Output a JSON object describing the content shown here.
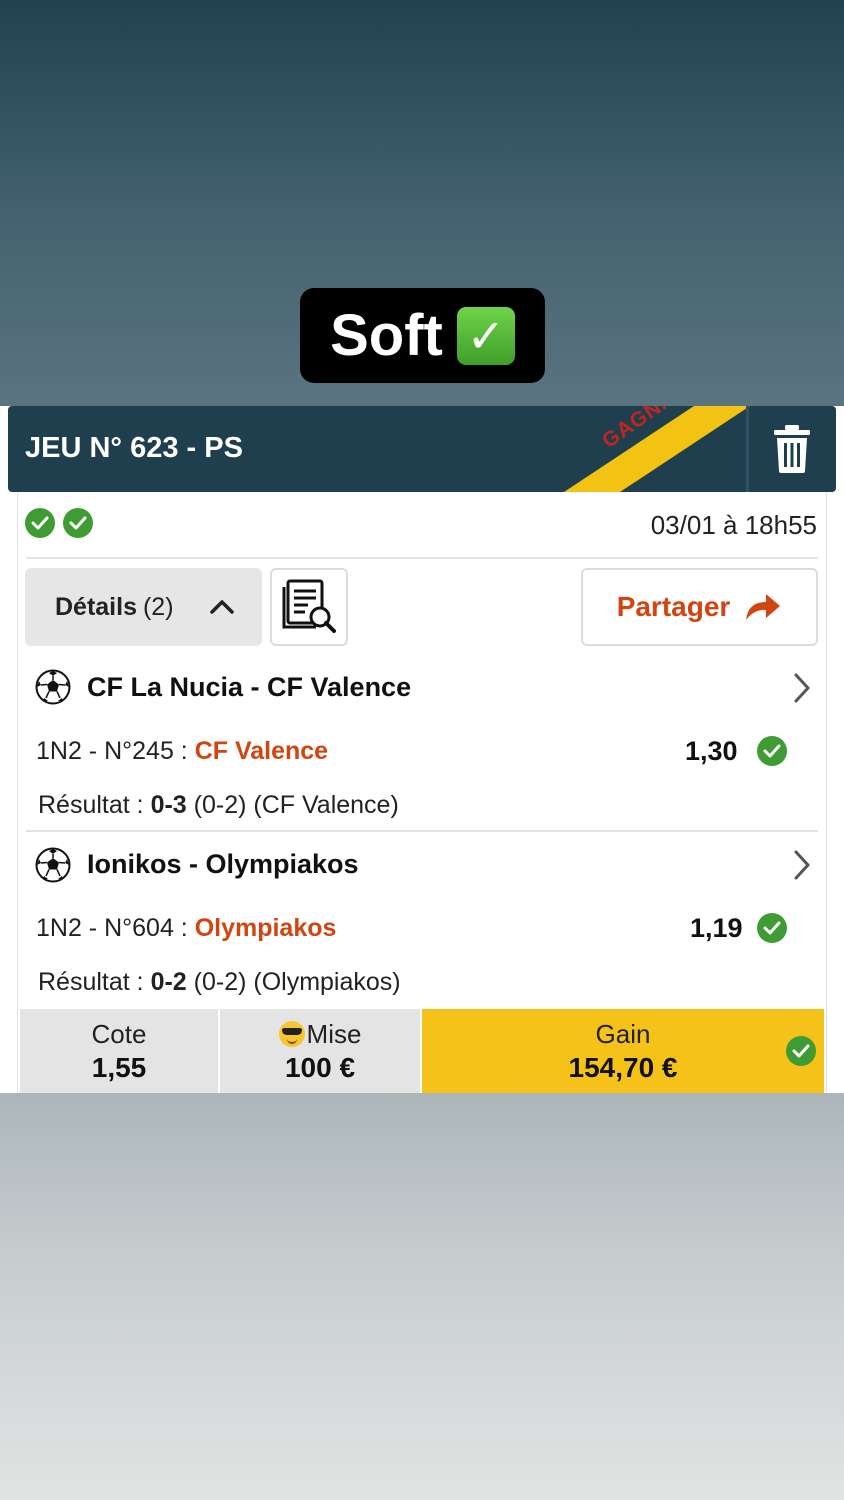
{
  "sticker": {
    "text": "Soft",
    "emoji": "check-mark-button"
  },
  "ticket": {
    "title": "JEU N° 623 - PS",
    "ribbon": "GAGNANT",
    "date": "03/01 à 18h55",
    "details_label": "Détails",
    "details_count": "(2)",
    "share_label": "Partager",
    "colors": {
      "header": "#1f3f4e",
      "ribbon": "#f3c313",
      "accent": "#d24410",
      "success": "#3f9c35",
      "gain_bg": "#f5c21a"
    }
  },
  "matches": [
    {
      "title": "CF La Nucia - CF Valence",
      "bet_prefix": "1N2 - N°245 : ",
      "pick": "CF Valence",
      "odds": "1,30",
      "result_label": "Résultat : ",
      "score": "0-3",
      "result_rest": " (0-2) (CF Valence)"
    },
    {
      "title": "Ionikos - Olympiakos",
      "bet_prefix": "1N2 - N°604 : ",
      "pick": "Olympiakos",
      "odds": "1,19",
      "result_label": "Résultat : ",
      "score": "0-2",
      "result_rest": " (0-2) (Olympiakos)"
    }
  ],
  "footer": {
    "cote_label": "Cote",
    "cote_value": "1,55",
    "mise_label": "Mise",
    "mise_value": "100 €",
    "gain_label": "Gain",
    "gain_value": "154,70 €"
  }
}
